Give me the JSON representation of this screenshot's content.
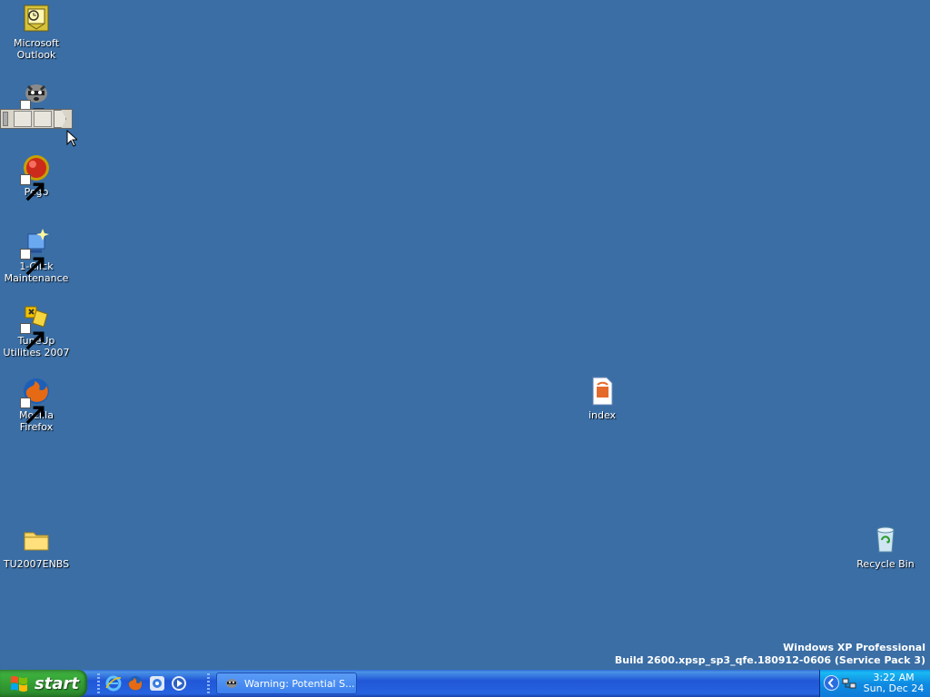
{
  "desktop": {
    "icons": [
      {
        "label": "Microsoft\nOutlook"
      },
      {
        "label": ""
      },
      {
        "label": "Pego"
      },
      {
        "label": "1-Click\nMaintenance"
      },
      {
        "label": "TuneUp\nUtilities 2007"
      },
      {
        "label": "Mozilla\nFirefox"
      },
      {
        "label": "TU2007ENBS"
      },
      {
        "label": "index"
      },
      {
        "label": "Recycle Bin"
      }
    ]
  },
  "watermark": {
    "line1": "Windows XP Professional",
    "line2": "Build 2600.xpsp_sp3_qfe.180912-0606 (Service Pack 3)"
  },
  "taskbar": {
    "start_label": "start",
    "quick_launch": [
      "internet-explorer-icon",
      "firefox-icon",
      "media-icon",
      "media-player-icon"
    ],
    "task_button_label": "Warning: Potential S...",
    "clock_time": "3:22 AM",
    "clock_date": "Sun, Dec 24"
  },
  "colors": {
    "desktop": "#3a6ea5",
    "taskbar": "#2157d7",
    "start": "#3bae3b",
    "tray": "#0f8ce3"
  }
}
